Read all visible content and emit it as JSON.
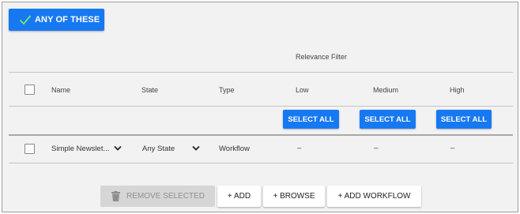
{
  "toolbar": {
    "any_label": "ANY OF THESE"
  },
  "relevance_filter_label": "Relevance Filter",
  "columns": {
    "name": "Name",
    "state": "State",
    "type": "Type",
    "low": "Low",
    "medium": "Medium",
    "high": "High"
  },
  "select_all_label": "SELECT ALL",
  "rows": [
    {
      "name": "Simple Newslet...",
      "state": "Any State",
      "type": "Workflow",
      "low": "–",
      "medium": "–",
      "high": "–"
    }
  ],
  "actions": {
    "remove_selected": "REMOVE SELECTED",
    "add": "+ ADD",
    "browse": "+ BROWSE",
    "add_workflow": "+ ADD WORKFLOW"
  },
  "colors": {
    "accent": "#1779f2",
    "check_green": "#7be36c",
    "panel_bg": "#f2f2f2"
  }
}
